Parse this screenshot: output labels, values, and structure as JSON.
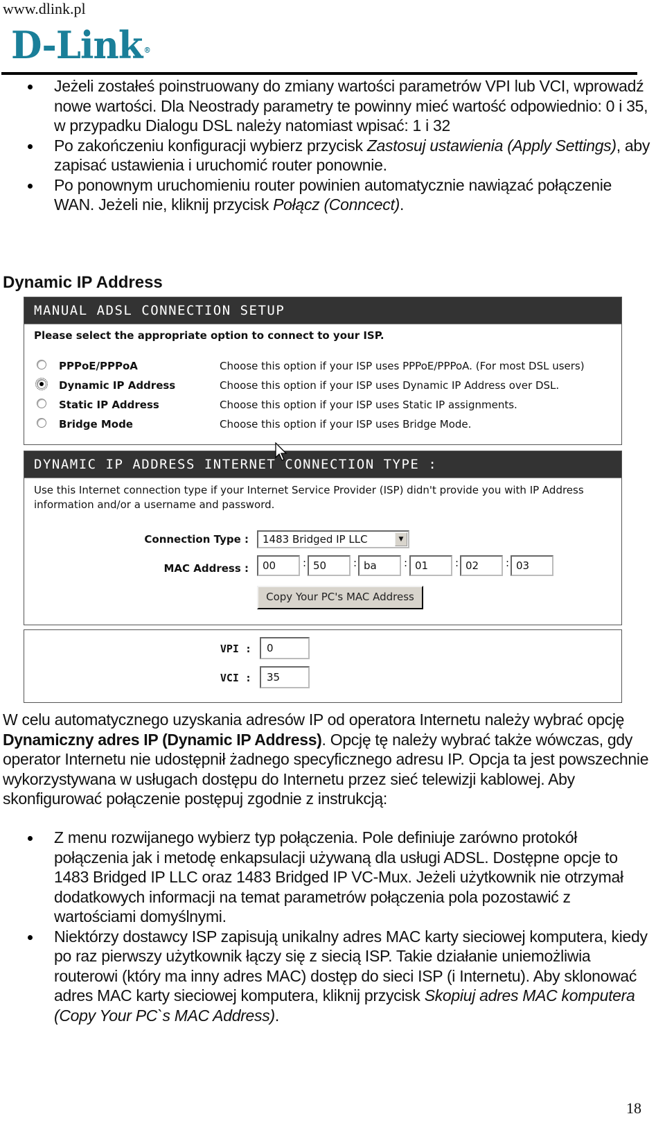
{
  "header": {
    "site_url": "www.dlink.pl",
    "logo_text": "D-Link",
    "logo_mark": "®",
    "brand_color": "#1a7f99"
  },
  "bullets_top": [
    {
      "text": "Jeżeli zostałeś poinstruowany do zmiany wartości parametrów VPI lub VCI, wprowadź nowe wartości. Dla Neostrady parametry te powinny mieć wartość odpowiednio: 0 i 35, w przypadku Dialogu DSL należy natomiast wpisać: 1 i 32"
    },
    {
      "before": "Po zakończeniu konfiguracji wybierz przycisk ",
      "italic": "Zastosuj ustawienia (Apply Settings)",
      "after": ", aby zapisać ustawienia i uruchomić router ponownie."
    },
    {
      "before": "Po ponownym uruchomieniu router powinien automatycznie nawiązać połączenie WAN. Jeżeli nie, kliknij przycisk ",
      "italic": "Połącz (Conncect)",
      "after": "."
    }
  ],
  "section_heading": "Dynamic IP Address",
  "setup_panel": {
    "title": "MANUAL ADSL CONNECTION SETUP",
    "prompt": "Please select the appropriate option to connect to your ISP.",
    "options": [
      {
        "label": "PPPoE/PPPoA",
        "description": "Choose this option if your ISP uses PPPoE/PPPoA. (For most DSL users)",
        "selected": false
      },
      {
        "label": "Dynamic IP Address",
        "description": "Choose this option if your ISP uses Dynamic IP Address over DSL.",
        "selected": true
      },
      {
        "label": "Static IP Address",
        "description": "Choose this option if your ISP uses Static IP assignments.",
        "selected": false
      },
      {
        "label": "Bridge Mode",
        "description": "Choose this option if your ISP uses Bridge Mode.",
        "selected": false
      }
    ]
  },
  "dynamic_panel": {
    "title": "DYNAMIC IP ADDRESS INTERNET CONNECTION TYPE :",
    "description": "Use this Internet connection type if your Internet Service Provider (ISP) didn't provide you with IP Address information and/or a username and password.",
    "connection_type_label": "Connection Type :",
    "connection_type_value": "1483 Bridged IP LLC",
    "mac_label": "MAC Address :",
    "mac_separator": ":",
    "mac_octets": [
      "00",
      "50",
      "ba",
      "01",
      "02",
      "03"
    ],
    "copy_mac_button": "Copy Your PC's MAC Address"
  },
  "vpi_panel": {
    "vpi_label": "VPI :",
    "vpi_value": "0",
    "vci_label": "VCI :",
    "vci_value": "35"
  },
  "body_paragraph": {
    "before": "W celu automatycznego uzyskania adresów IP od operatora Internetu należy wybrać opcję ",
    "bold": "Dynamiczny adres IP (Dynamic IP Address)",
    "after": ". Opcję tę należy wybrać także wówczas, gdy operator Internetu nie udostępnił żadnego specyficznego adresu IP. Opcja ta jest powszechnie wykorzystywana w usługach dostępu do Internetu przez sieć telewizji kablowej. Aby skonfigurować połączenie postępuj zgodnie z instrukcją:"
  },
  "bullets_bottom": [
    {
      "text": "Z menu rozwijanego wybierz typ połączenia. Pole definiuje zarówno protokół połączenia jak i metodę enkapsulacji używaną dla usługi ADSL. Dostępne opcje to 1483 Bridged IP LLC oraz 1483 Bridged IP VC-Mux. Jeżeli użytkownik nie otrzymał dodatkowych informacji na temat parametrów połączenia pola pozostawić z wartościami domyślnymi."
    },
    {
      "before": "Niektórzy dostawcy ISP zapisują unikalny adres MAC karty sieciowej komputera, kiedy po raz pierwszy użytkownik łączy się z siecią ISP. Takie działanie uniemożliwia routerowi (który ma inny adres MAC) dostęp do sieci ISP (i Internetu). Aby sklonować adres MAC karty sieciowej komputera, kliknij przycisk ",
      "italic": "Skopiuj adres MAC komputera (Copy Your PC`s MAC Address)",
      "after": "."
    }
  ],
  "page_number": "18"
}
